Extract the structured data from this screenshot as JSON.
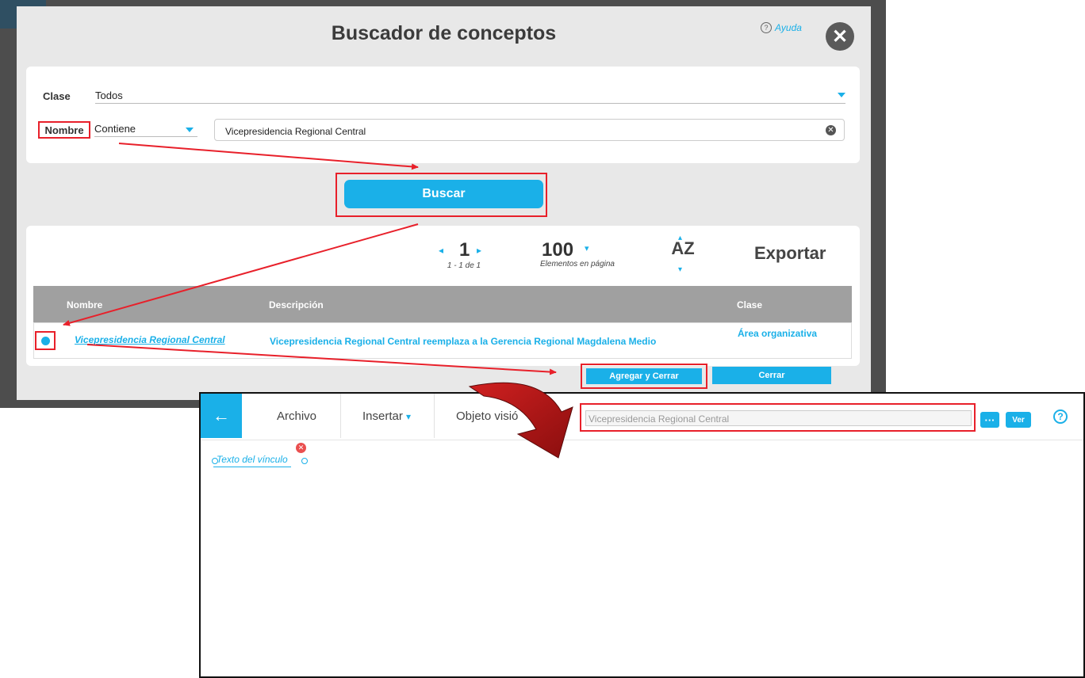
{
  "dialog": {
    "title": "Buscador de conceptos",
    "help_label": "Ayuda",
    "help_icon": "?",
    "close_icon": "✕",
    "filters": {
      "clase_label": "Clase",
      "clase_value": "Todos",
      "nombre_label": "Nombre",
      "nombre_operator": "Contiene",
      "search_value": "Vicepresidencia Regional Central",
      "clear_icon": "✕"
    },
    "search_button": "Buscar",
    "pagination": {
      "page": "1",
      "range": "1 - 1 de 1",
      "per_page": "100",
      "per_page_label": "Elementos en página",
      "sort_label": "AZ",
      "export_label": "Exportar"
    },
    "table": {
      "headers": [
        "Nombre",
        "Descripción",
        "Clase"
      ],
      "rows": [
        {
          "nombre": "Vicepresidencia Regional Central",
          "descripcion": "Vicepresidencia Regional Central reemplaza a la Gerencia Regional Magdalena Medio",
          "clase": "Área organizativa"
        }
      ]
    },
    "add_close_button": "Agregar y Cerrar",
    "close_button": "Cerrar"
  },
  "editor": {
    "back_icon": "←",
    "menu": [
      "Archivo",
      "Insertar",
      "Objeto visió"
    ],
    "link_field_value": "Vicepresidencia Regional Central",
    "more_button": "···",
    "view_button": "Ver",
    "help_icon": "?",
    "link_text": "Texto del vínculo",
    "link_close_icon": "✕"
  },
  "colors": {
    "accent": "#1ab0e8",
    "highlight": "#e8202a",
    "big_arrow": "#b01a1a"
  }
}
